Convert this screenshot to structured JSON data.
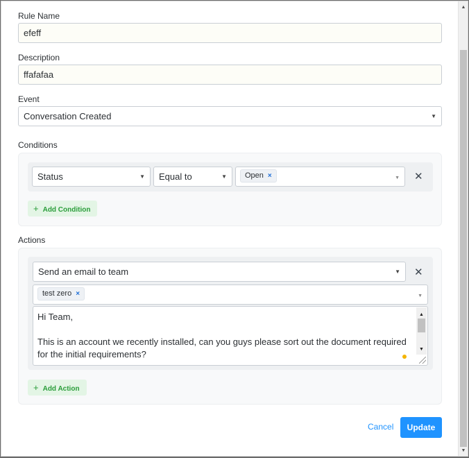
{
  "form": {
    "rule_name_label": "Rule Name",
    "rule_name_value": "efeff",
    "description_label": "Description",
    "description_value": "ffafafaa",
    "event_label": "Event",
    "event_value": "Conversation Created"
  },
  "conditions": {
    "label": "Conditions",
    "attribute": "Status",
    "operator": "Equal to",
    "value_tag": "Open",
    "add_label": "Add Condition"
  },
  "actions": {
    "label": "Actions",
    "action_type": "Send an email to team",
    "team_tag": "test zero",
    "message_line1": "Hi Team,",
    "message_line2": "This is an account we recently installed, can you guys please sort out the document required for the initial requirements?",
    "add_label": "Add Action"
  },
  "footer": {
    "cancel_label": "Cancel",
    "update_label": "Update"
  },
  "colors": {
    "primary": "#1f93ff",
    "success_text": "#2a9d3a",
    "success_bg": "#e3f5e5"
  },
  "icons": {
    "select_caret": "▼",
    "tag_remove": "×",
    "row_remove": "✕",
    "add": "+"
  }
}
